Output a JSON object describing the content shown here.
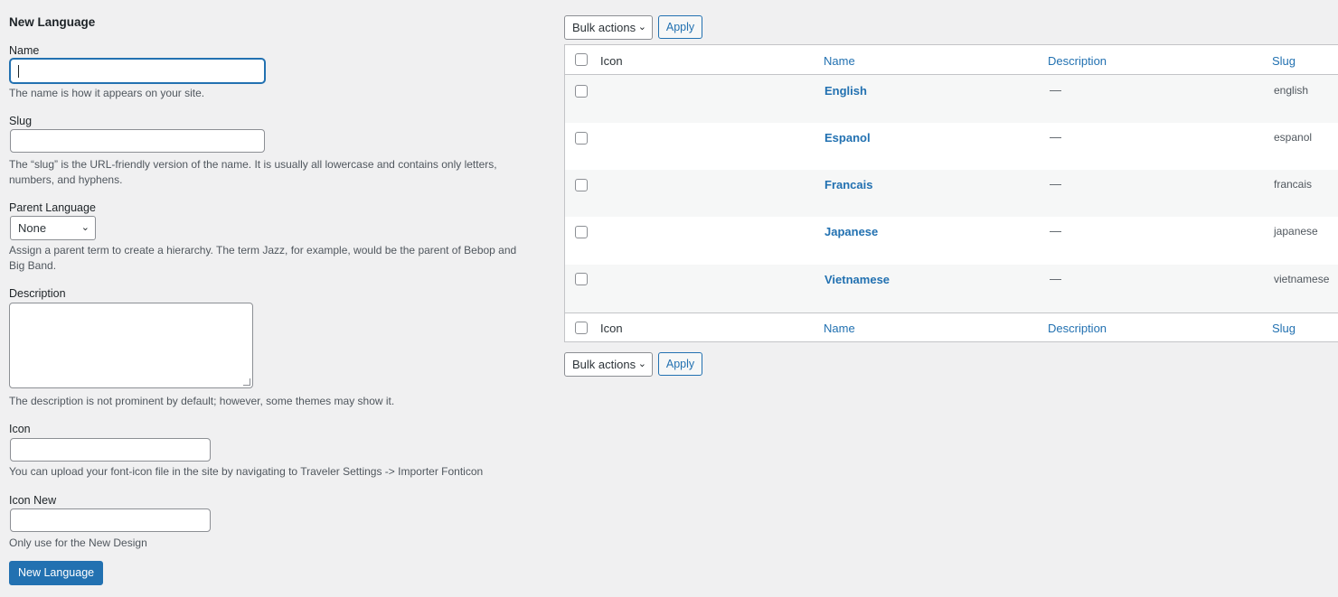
{
  "form": {
    "title": "New Language",
    "name_label": "Name",
    "name_value": "",
    "name_help": "The name is how it appears on your site.",
    "slug_label": "Slug",
    "slug_value": "",
    "slug_help": "The “slug” is the URL-friendly version of the name. It is usually all lowercase and contains only letters, numbers, and hyphens.",
    "parent_label": "Parent Language",
    "parent_value": "None",
    "parent_help": "Assign a parent term to create a hierarchy. The term Jazz, for example, would be the parent of Bebop and Big Band.",
    "description_label": "Description",
    "description_value": "",
    "description_help": "The description is not prominent by default; however, some themes may show it.",
    "icon_label": "Icon",
    "icon_value": "",
    "icon_help": "You can upload your font-icon file in the site by navigating to Traveler Settings -> Importer Fonticon",
    "icon_new_label": "Icon New",
    "icon_new_value": "",
    "icon_new_help": "Only use for the New Design",
    "submit_label": "New Language"
  },
  "toolbar": {
    "bulk_label": "Bulk actions",
    "apply_label": "Apply"
  },
  "table": {
    "columns": {
      "icon": "Icon",
      "name": "Name",
      "description": "Description",
      "slug": "Slug"
    },
    "rows": [
      {
        "name": "English",
        "description": "—",
        "slug": "english"
      },
      {
        "name": "Espanol",
        "description": "—",
        "slug": "espanol"
      },
      {
        "name": "Francais",
        "description": "—",
        "slug": "francais"
      },
      {
        "name": "Japanese",
        "description": "—",
        "slug": "japanese"
      },
      {
        "name": "Vietnamese",
        "description": "—",
        "slug": "vietnamese"
      }
    ]
  },
  "colors": {
    "accent": "#2271b1",
    "background": "#f0f0f1"
  }
}
